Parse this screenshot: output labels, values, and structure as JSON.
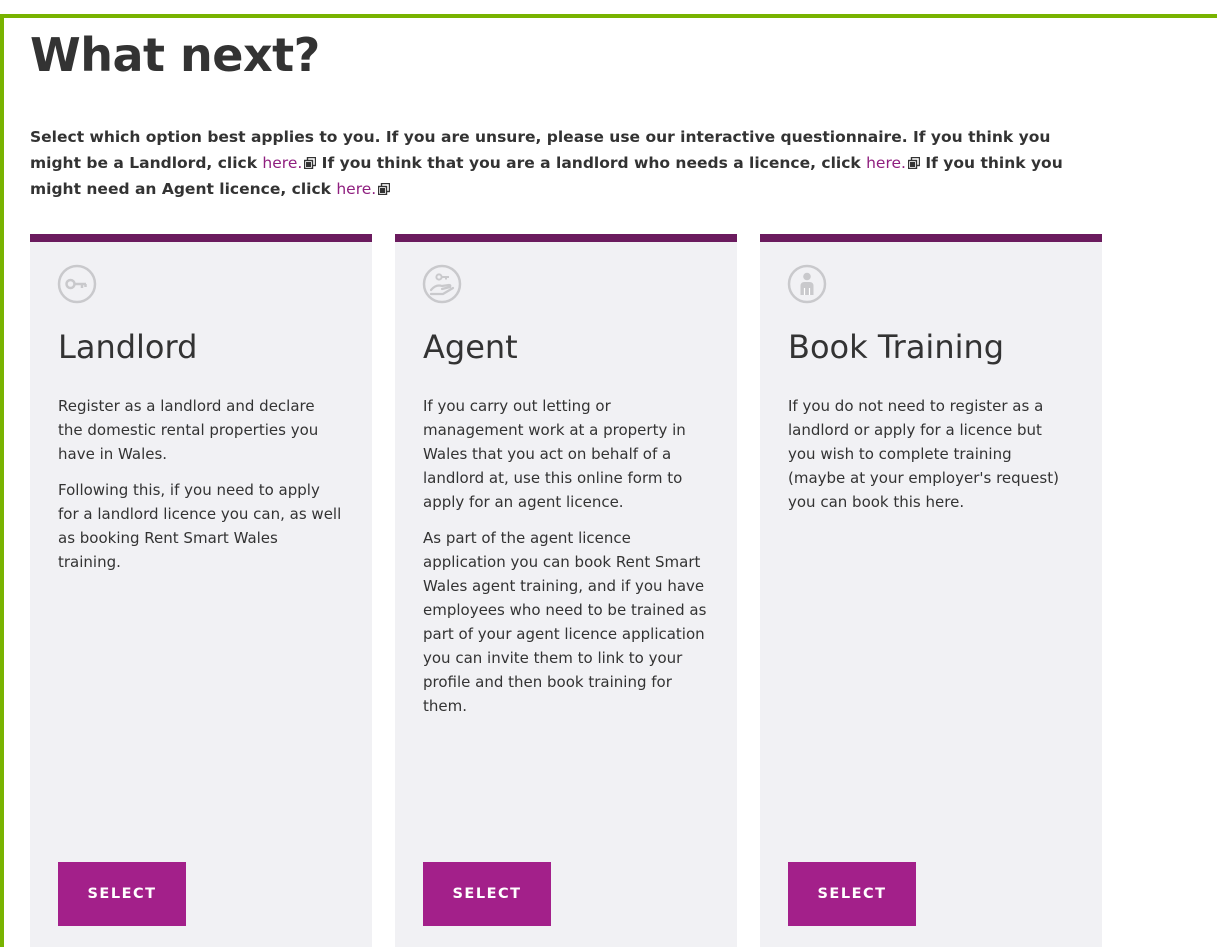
{
  "heading": "What next?",
  "intro": {
    "p1": "Select which option best applies to you. If you are unsure, please use our interactive questionnaire. If you think you might be a Landlord, click ",
    "link1": "here.",
    "p2": " If you think that you are a landlord who needs a licence, click ",
    "link2": "here.",
    "p3": " If you think you might need an Agent licence, click ",
    "link3": "here."
  },
  "colors": {
    "frame_border": "#78b300",
    "card_top_border": "#6b1b5e",
    "card_background": "#f1f1f4",
    "button": "#a3208a",
    "link": "#8f1f7f"
  },
  "cards": [
    {
      "icon": "key-icon",
      "title": "Landlord",
      "paragraphs": [
        "Register as a landlord and declare the domestic rental properties you have in Wales.",
        "Following this, if you need to apply for a landlord licence you can, as well as booking Rent Smart Wales training."
      ],
      "button": "SELECT"
    },
    {
      "icon": "hand-key-icon",
      "title": "Agent",
      "paragraphs": [
        "If you carry out letting or management work at a property in Wales that you act on behalf of a landlord at, use this online form to apply for an agent licence.",
        "As part of the agent licence application you can book Rent Smart Wales agent training, and if you have employees who need to be trained as part of your agent licence application you can invite them to link to your profile and then book training for them."
      ],
      "button": "SELECT"
    },
    {
      "icon": "person-icon",
      "title": "Book Training",
      "paragraphs": [
        "If you do not need to register as a landlord or apply for a licence but you wish to complete training (maybe at your employer's request) you can book this here."
      ],
      "button": "SELECT"
    }
  ]
}
